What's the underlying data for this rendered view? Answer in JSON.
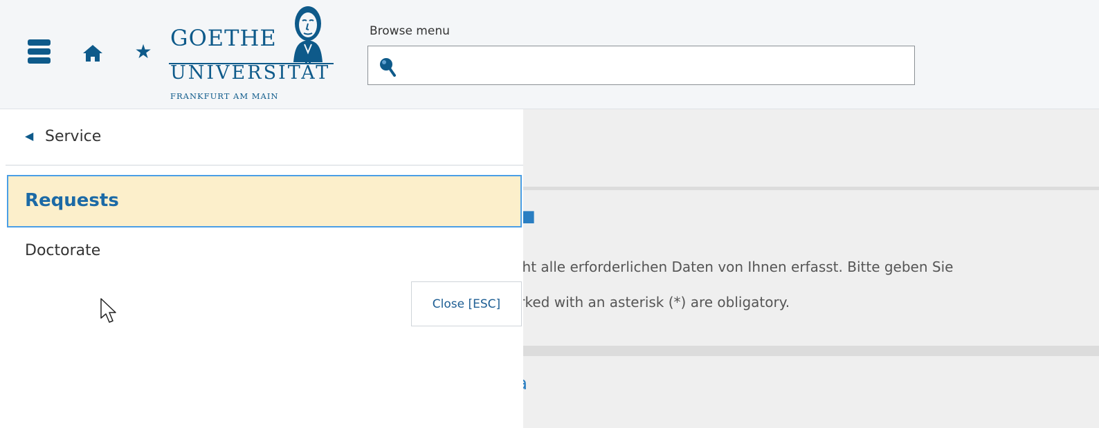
{
  "header": {
    "logo": {
      "line1": "GOETHE",
      "line2": "UNIVERSITÄT",
      "line3": "FRANKFURT AM MAIN"
    },
    "search": {
      "label": "Browse menu",
      "placeholder": "",
      "value": ""
    },
    "icons": {
      "menu": "hamburger-menu-icon",
      "home": "home-icon",
      "favorite": "star-icon",
      "search": "search-pin-icon"
    }
  },
  "menu": {
    "back_label": "Service",
    "items": [
      {
        "label": "Requests",
        "active": true
      },
      {
        "label": "Doctorate",
        "active": false
      }
    ],
    "close_label": "Close [ESC]"
  },
  "background": {
    "line1": "icht alle erforderlichen Daten von Ihnen erfasst. Bitte geben Sie",
    "line2": "arked with an asterisk (*) are obligatory.",
    "heading2": "ta"
  },
  "colors": {
    "brand": "#0e5a8a",
    "link": "#2a7ec2",
    "active_bg": "#fcefcb",
    "active_border": "#4a9ee6"
  }
}
